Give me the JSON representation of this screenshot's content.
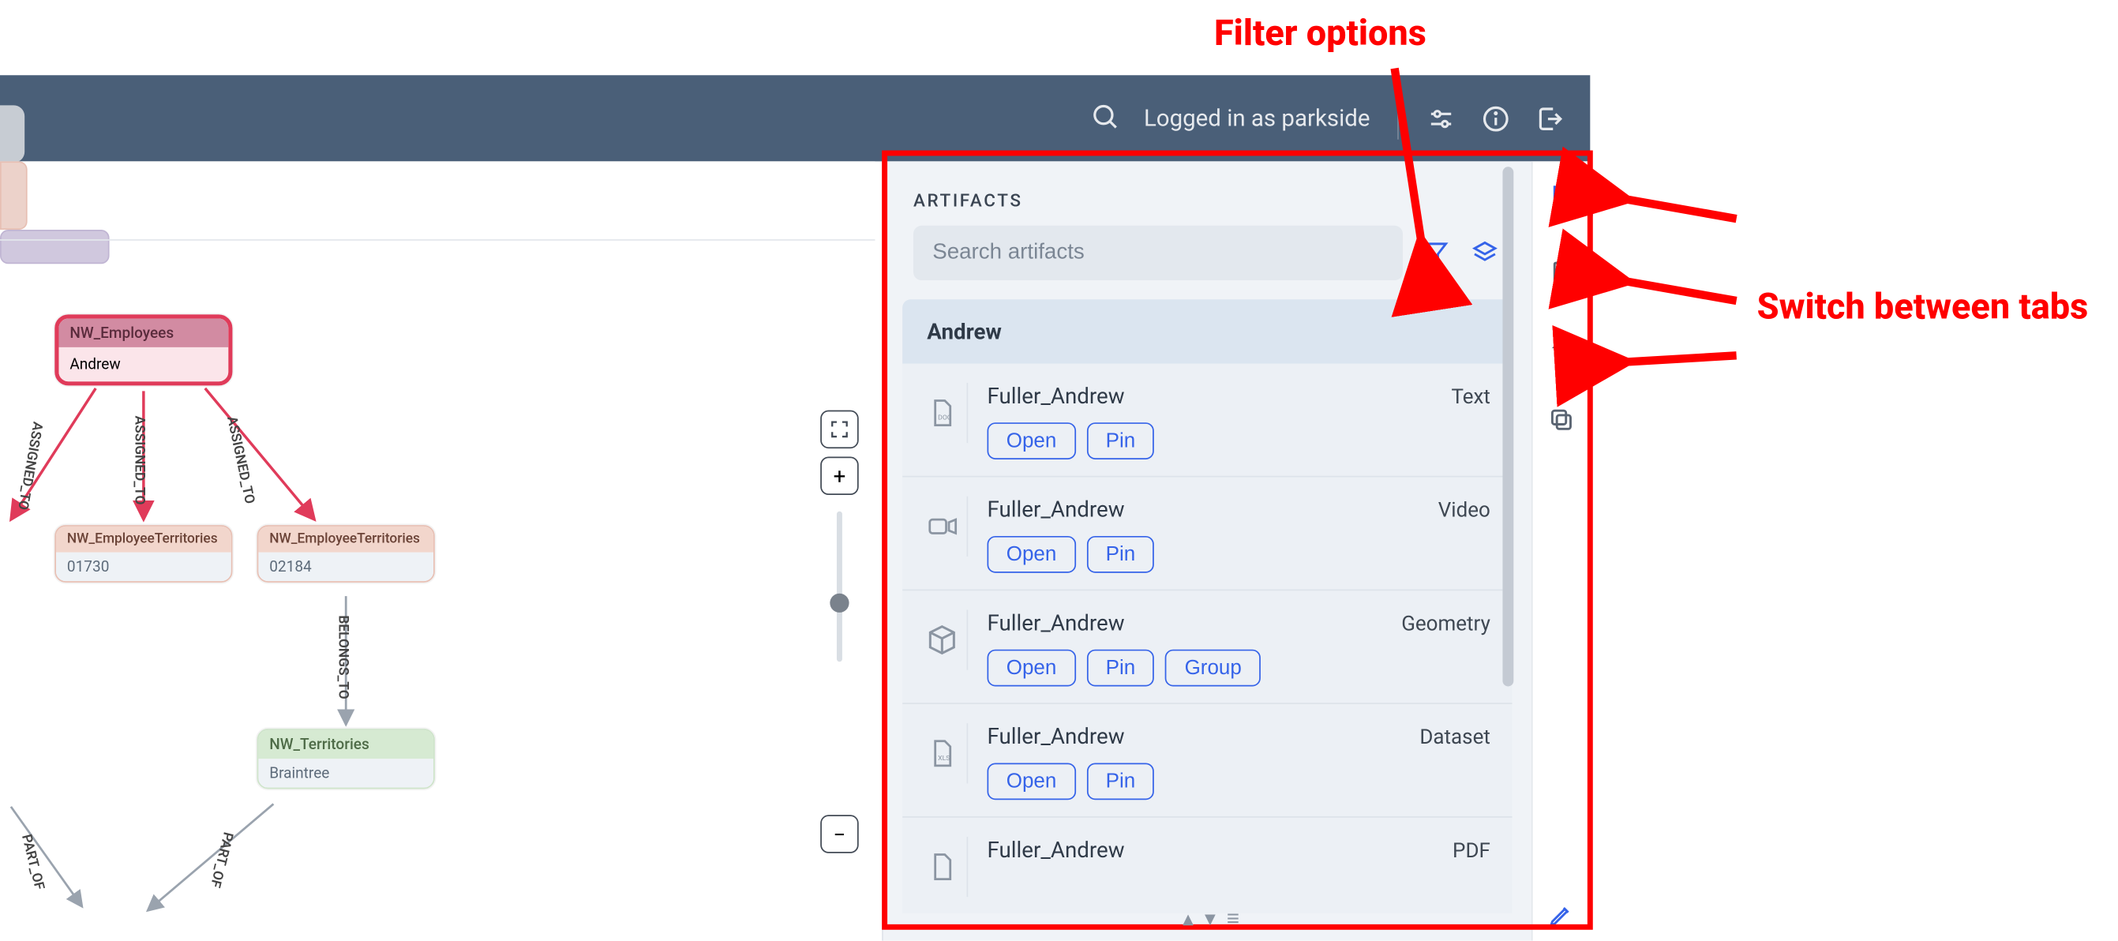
{
  "topbar": {
    "logged_in": "Logged in as parkside"
  },
  "graph": {
    "nodes": {
      "emp": {
        "type": "NW_Employees",
        "body": "Andrew"
      },
      "et2": {
        "type": "NW_EmployeeTerritories",
        "body": "01730"
      },
      "et3": {
        "type": "NW_EmployeeTerritories",
        "body": "02184"
      },
      "terr": {
        "type": "NW_Territories",
        "body": "Braintree"
      }
    },
    "edges": {
      "assigned1": "ASSIGNED_TO",
      "assigned2": "ASSIGNED_TO",
      "assigned3": "ASSIGNED_TO",
      "belongs": "BELONGS_TO",
      "partof1": "PART_OF",
      "partof2": "PART_OF"
    }
  },
  "panel": {
    "title": "ARTIFACTS",
    "search_placeholder": "Search artifacts",
    "group_label": "Andrew",
    "items": [
      {
        "name": "Fuller_Andrew",
        "tag": "Text",
        "icon": "doc",
        "actions": [
          "Open",
          "Pin"
        ]
      },
      {
        "name": "Fuller_Andrew",
        "tag": "Video",
        "icon": "video",
        "actions": [
          "Open",
          "Pin"
        ]
      },
      {
        "name": "Fuller_Andrew",
        "tag": "Geometry",
        "icon": "cube",
        "actions": [
          "Open",
          "Pin",
          "Group"
        ]
      },
      {
        "name": "Fuller_Andrew",
        "tag": "Dataset",
        "icon": "xls",
        "actions": [
          "Open",
          "Pin"
        ]
      },
      {
        "name": "Fuller_Andrew",
        "tag": "PDF",
        "icon": "pdf",
        "actions": []
      }
    ]
  },
  "annotations": {
    "filter": "Filter options",
    "tabs": "Switch between tabs"
  }
}
